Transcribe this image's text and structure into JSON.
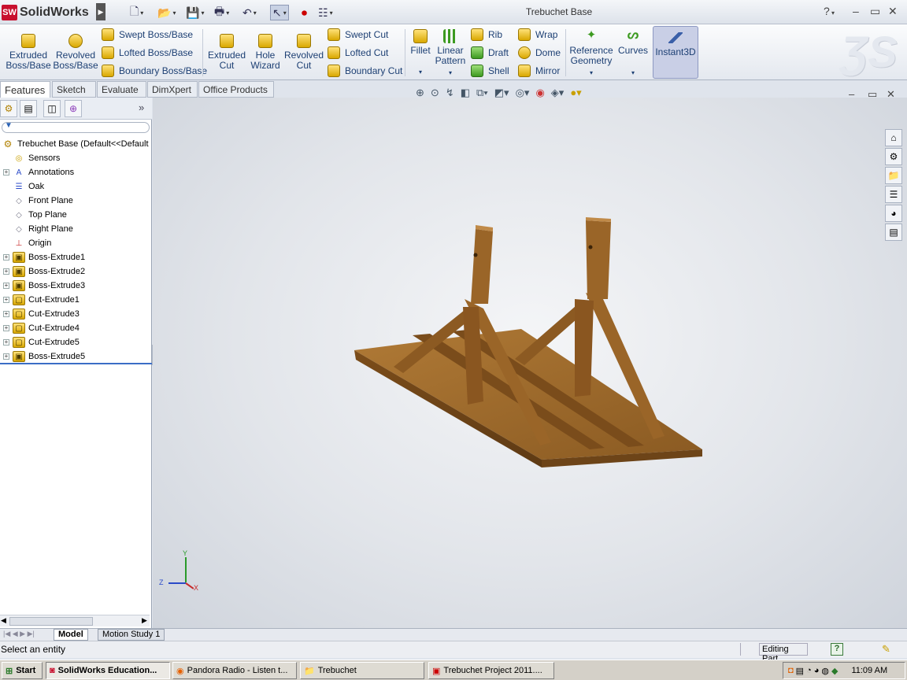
{
  "app": {
    "name": "SolidWorks",
    "logo_badge": "SW",
    "document_title": "Trebuchet Base"
  },
  "quick_access": {
    "icons": [
      "new-document-icon",
      "open-folder-icon",
      "save-icon",
      "print-icon",
      "undo-icon",
      "select-arrow-icon",
      "rebuild-icon",
      "options-icon"
    ]
  },
  "window_controls": {
    "help": "?",
    "minimize": "–",
    "restore": "▭",
    "close": "✕"
  },
  "ribbon": {
    "extruded_boss": "Extruded\nBoss/Base",
    "revolved_boss": "Revolved\nBoss/Base",
    "swept_boss": "Swept Boss/Base",
    "lofted_boss": "Lofted Boss/Base",
    "boundary_boss": "Boundary Boss/Base",
    "extruded_cut": "Extruded\nCut",
    "hole_wizard": "Hole\nWizard",
    "revolved_cut": "Revolved\nCut",
    "swept_cut": "Swept Cut",
    "lofted_cut": "Lofted Cut",
    "boundary_cut": "Boundary Cut",
    "fillet": "Fillet",
    "linear_pattern": "Linear\nPattern",
    "rib": "Rib",
    "draft": "Draft",
    "shell": "Shell",
    "wrap": "Wrap",
    "dome": "Dome",
    "mirror": "Mirror",
    "reference_geometry": "Reference\nGeometry",
    "curves": "Curves",
    "instant3d": "Instant3D"
  },
  "command_tabs": [
    "Features",
    "Sketch",
    "Evaluate",
    "DimXpert",
    "Office Products"
  ],
  "feature_tree": {
    "root": "Trebuchet Base  (Default<<Default",
    "items": [
      {
        "label": "Sensors",
        "expandable": false,
        "icon": "sensor-icon"
      },
      {
        "label": "Annotations",
        "expandable": true,
        "icon": "annotation-icon"
      },
      {
        "label": "Oak",
        "expandable": false,
        "icon": "material-icon"
      },
      {
        "label": "Front Plane",
        "expandable": false,
        "icon": "plane-icon"
      },
      {
        "label": "Top Plane",
        "expandable": false,
        "icon": "plane-icon"
      },
      {
        "label": "Right Plane",
        "expandable": false,
        "icon": "plane-icon"
      },
      {
        "label": "Origin",
        "expandable": false,
        "icon": "origin-icon"
      },
      {
        "label": "Boss-Extrude1",
        "expandable": true,
        "icon": "extrude-icon"
      },
      {
        "label": "Boss-Extrude2",
        "expandable": true,
        "icon": "extrude-icon"
      },
      {
        "label": "Boss-Extrude3",
        "expandable": true,
        "icon": "extrude-icon"
      },
      {
        "label": "Cut-Extrude1",
        "expandable": true,
        "icon": "cut-icon"
      },
      {
        "label": "Cut-Extrude3",
        "expandable": true,
        "icon": "cut-icon"
      },
      {
        "label": "Cut-Extrude4",
        "expandable": true,
        "icon": "cut-icon"
      },
      {
        "label": "Cut-Extrude5",
        "expandable": true,
        "icon": "cut-icon"
      },
      {
        "label": "Boss-Extrude5",
        "expandable": true,
        "icon": "extrude-icon"
      }
    ]
  },
  "triad": {
    "y": "Y",
    "z": "Z",
    "x": "X"
  },
  "bottom_tabs": [
    "Model",
    "Motion Study 1"
  ],
  "status": {
    "message": "Select an entity",
    "mode": "Editing Part",
    "help": "?"
  },
  "taskbar": {
    "start": "Start",
    "buttons": [
      "SolidWorks Education...",
      "Pandora Radio - Listen t...",
      "Trebuchet",
      "Trebuchet Project 2011...."
    ],
    "clock": "11:09 AM"
  },
  "colors": {
    "wood": "#8b5a22",
    "wood_dark": "#6b4218",
    "accent": "#c8102e",
    "instant3d_bg": "#c9cfe6"
  }
}
